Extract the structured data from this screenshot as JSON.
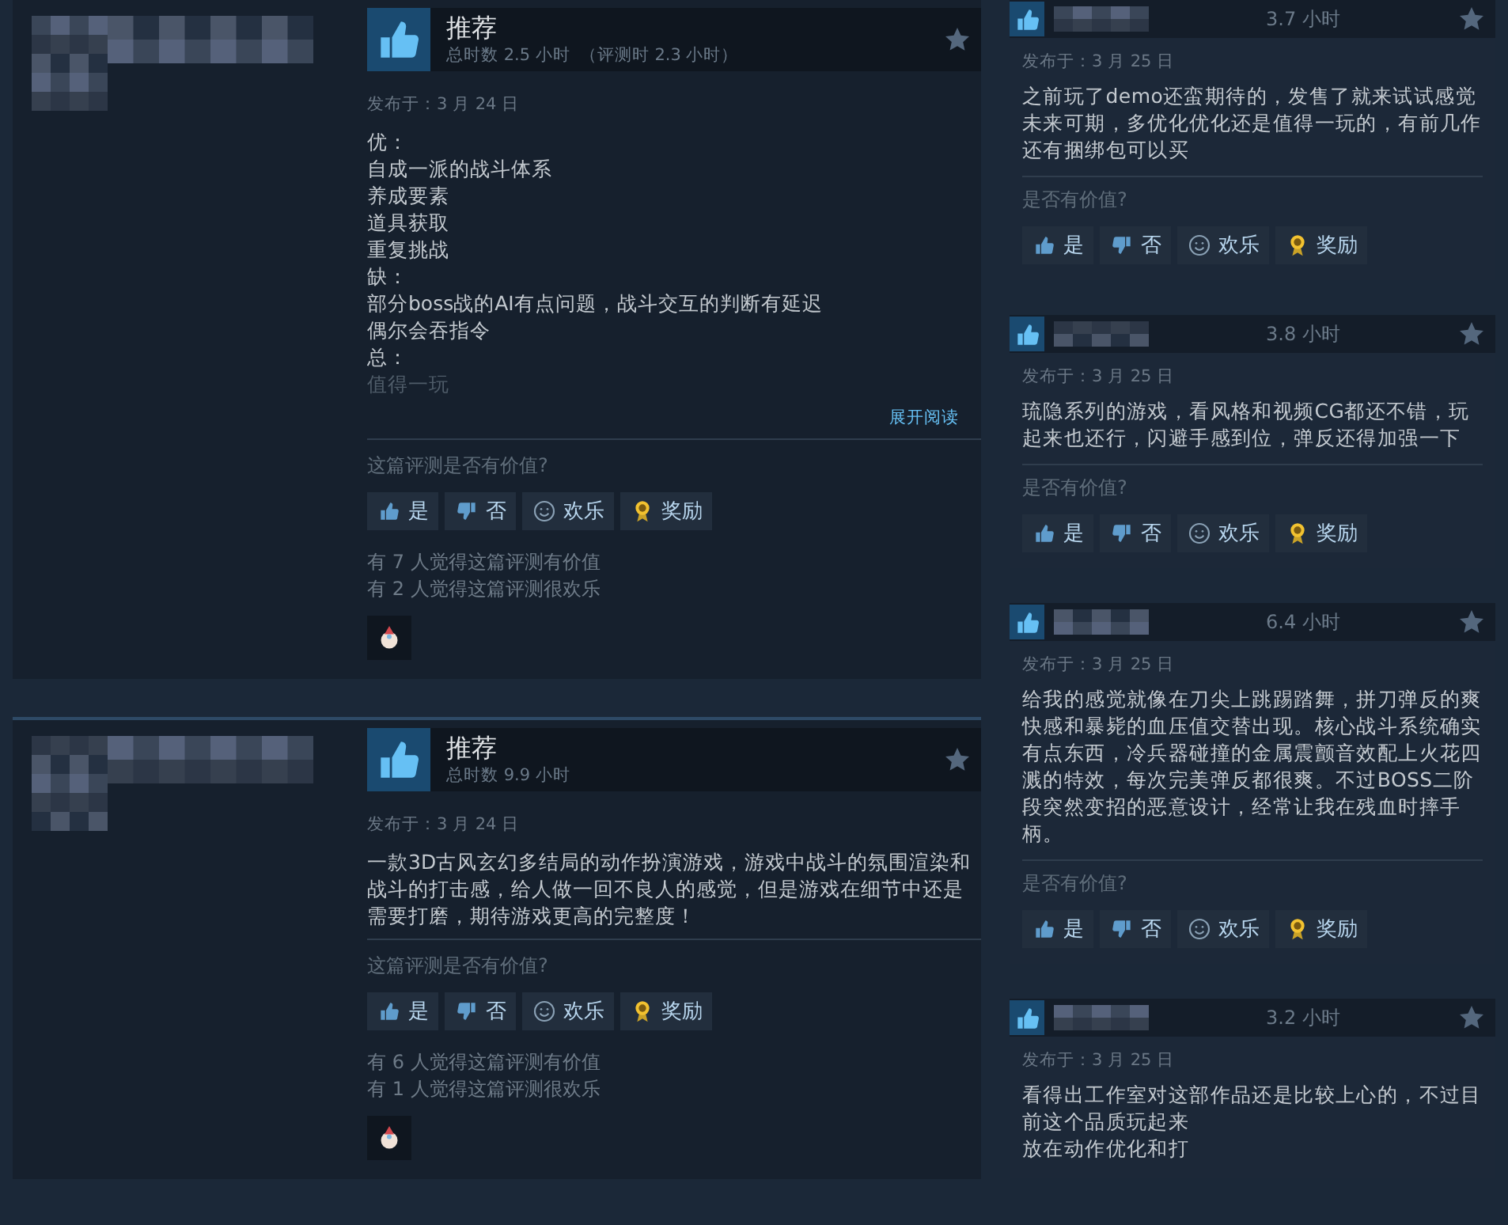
{
  "main_reviews": [
    {
      "recommended": true,
      "verdict": "推荐",
      "playtime": "总时数 2.5 小时",
      "review_playtime": "（评测时 2.3 小时）",
      "posted": "发布于：3 月 24 日",
      "body": [
        "优：",
        "自成一派的战斗体系",
        "养成要素",
        "道具获取",
        "重复挑战",
        "缺：",
        "部分boss战的AI有点问题，战斗交互的判断有延迟",
        "偶尔会吞指令",
        "总："
      ],
      "faded_line": "值得一玩",
      "expand_link": "展开阅读",
      "helpful_prompt": "这篇评测是否有价值?",
      "buttons": [
        {
          "kind": "yes",
          "label": "是"
        },
        {
          "kind": "no",
          "label": "否"
        },
        {
          "kind": "funny",
          "label": "欢乐"
        },
        {
          "kind": "award",
          "label": "奖励"
        }
      ],
      "votes": [
        "有 7 人觉得这篇评测有价值",
        "有 2 人觉得这篇评测很欢乐"
      ]
    },
    {
      "recommended": true,
      "verdict": "推荐",
      "playtime": "总时数 9.9 小时",
      "posted": "发布于：3 月 24 日",
      "body": [
        "一款3D古风玄幻多结局的动作扮演游戏，游戏中战斗的氛围渲染和战斗的打击感，给人做一回不良人的感觉，但是游戏在细节中还是需要打磨，期待游戏更高的完整度！"
      ],
      "helpful_prompt": "这篇评测是否有价值?",
      "buttons": [
        {
          "kind": "yes",
          "label": "是"
        },
        {
          "kind": "no",
          "label": "否"
        },
        {
          "kind": "funny",
          "label": "欢乐"
        },
        {
          "kind": "award",
          "label": "奖励"
        }
      ],
      "votes": [
        "有 6 人觉得这篇评测有价值",
        "有 1 人觉得这篇评测很欢乐"
      ]
    }
  ],
  "side_reviews": [
    {
      "recommended": true,
      "hours": "3.7 小时",
      "posted": "发布于：3 月 25 日",
      "body": [
        "之前玩了demo还蛮期待的，发售了就来试试感觉未来可期，多优化优化还是值得一玩的，有前几作还有捆绑包可以买"
      ],
      "helpful_prompt": "是否有价值?",
      "buttons": [
        {
          "kind": "yes",
          "label": "是"
        },
        {
          "kind": "no",
          "label": "否"
        },
        {
          "kind": "funny",
          "label": "欢乐"
        },
        {
          "kind": "award",
          "label": "奖励"
        }
      ]
    },
    {
      "recommended": true,
      "hours": "3.8 小时",
      "posted": "发布于：3 月 25 日",
      "body": [
        "琉隐系列的游戏，看风格和视频CG都还不错，玩起来也还行，闪避手感到位，弹反还得加强一下"
      ],
      "helpful_prompt": "是否有价值?",
      "buttons": [
        {
          "kind": "yes",
          "label": "是"
        },
        {
          "kind": "no",
          "label": "否"
        },
        {
          "kind": "funny",
          "label": "欢乐"
        },
        {
          "kind": "award",
          "label": "奖励"
        }
      ]
    },
    {
      "recommended": true,
      "hours": "6.4 小时",
      "posted": "发布于：3 月 25 日",
      "body": [
        "给我的感觉就像在刀尖上跳踢踏舞，拼刀弹反的爽快感和暴毙的血压值交替出现。核心战斗系统确实有点东西，冷兵器碰撞的金属震颤音效配上火花四溅的特效，每次完美弹反都很爽。不过BOSS二阶段突然变招的恶意设计，经常让我在残血时摔手柄。"
      ],
      "helpful_prompt": "是否有价值?",
      "buttons": [
        {
          "kind": "yes",
          "label": "是"
        },
        {
          "kind": "no",
          "label": "否"
        },
        {
          "kind": "funny",
          "label": "欢乐"
        },
        {
          "kind": "award",
          "label": "奖励"
        }
      ]
    },
    {
      "recommended": true,
      "hours": "3.2 小时",
      "posted": "发布于：3 月 25 日",
      "body": [
        "看得出工作室对这部作品还是比较上心的，不过目前这个品质玩起来",
        "放在动作优化和打"
      ]
    }
  ]
}
